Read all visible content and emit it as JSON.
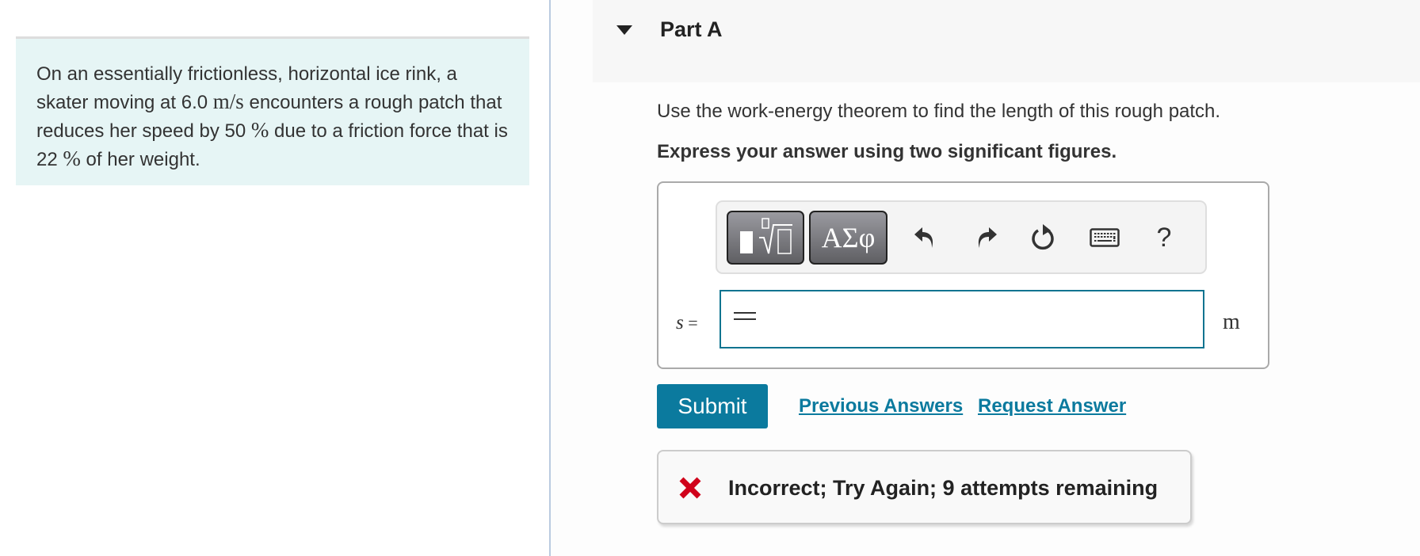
{
  "problem": {
    "text_1": "On an essentially frictionless, horizontal ice rink, a skater moving at 6.0 ",
    "unit_speed": "m/s",
    "text_2": " encounters a rough patch that reduces her speed by 50 ",
    "percent_1": "%",
    "text_3": " due to a friction force that is 22 ",
    "percent_2": "%",
    "text_4": " of her weight."
  },
  "part": {
    "title": "Part A",
    "expanded": true,
    "instruction": "Use the work-energy theorem to find the length of this rough patch.",
    "instruction_bold": "Express your answer using two significant figures."
  },
  "toolbar": {
    "templates_icon": "templates-sqrt-icon",
    "greek_label": "ΑΣφ",
    "undo_icon": "undo-icon",
    "redo_icon": "redo-icon",
    "reset_icon": "reset-icon",
    "keyboard_icon": "keyboard-icon",
    "help_label": "?"
  },
  "answer": {
    "variable": "s",
    "equals": "=",
    "value": "",
    "unit": "m"
  },
  "actions": {
    "submit_label": "Submit",
    "previous_answers_label": "Previous Answers",
    "request_answer_label": "Request Answer"
  },
  "feedback": {
    "status": "incorrect",
    "message": "Incorrect; Try Again; 9 attempts remaining",
    "color": "#d0021b"
  },
  "colors": {
    "accent": "#0b7a9e",
    "problem_bg": "#e6f5f5",
    "header_bg": "#f7f7f7"
  }
}
